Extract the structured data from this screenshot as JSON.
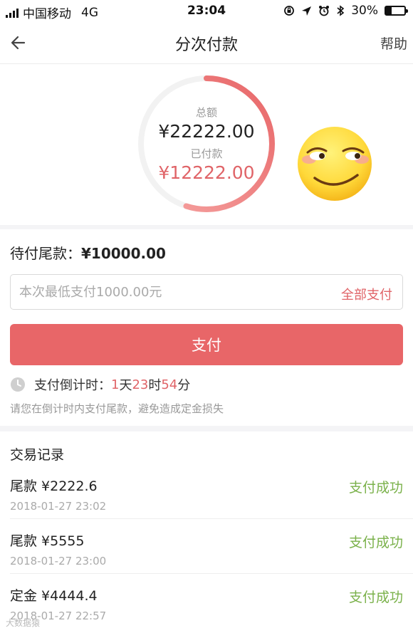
{
  "status_bar": {
    "carrier": "中国移动",
    "network": "4G",
    "time": "23:04",
    "battery": "30%"
  },
  "nav": {
    "title": "分次付款",
    "help": "帮助"
  },
  "summary": {
    "total_label": "总额",
    "total_value": "¥22222.00",
    "paid_label": "已付款",
    "paid_value": "¥12222.00",
    "paid_fraction": 0.55
  },
  "payment": {
    "remaining_label": "待付尾款：",
    "remaining_value": "¥10000.00",
    "input_placeholder": "本次最低支付1000.00元",
    "input_value": "",
    "pay_all": "全部支付",
    "pay_button": "支付",
    "countdown_label": "支付倒计时：",
    "countdown": {
      "days": "1",
      "day_unit": "天",
      "hours": "23",
      "hour_unit": "时",
      "minutes": "54",
      "minute_unit": "分"
    },
    "warning": "请您在倒计时内支付尾款，避免造成定金损失"
  },
  "records": {
    "title": "交易记录",
    "items": [
      {
        "name": "尾款 ¥2222.6",
        "time": "2018-01-27 23:02",
        "status": "支付成功"
      },
      {
        "name": "尾款 ¥5555",
        "time": "2018-01-27 23:00",
        "status": "支付成功"
      },
      {
        "name": "定金 ¥4444.4",
        "time": "2018-01-27 22:57",
        "status": "支付成功"
      }
    ]
  },
  "watermark": "大数据猿",
  "colors": {
    "accent": "#e86668",
    "success": "#7ab14a",
    "muted": "#999999"
  }
}
